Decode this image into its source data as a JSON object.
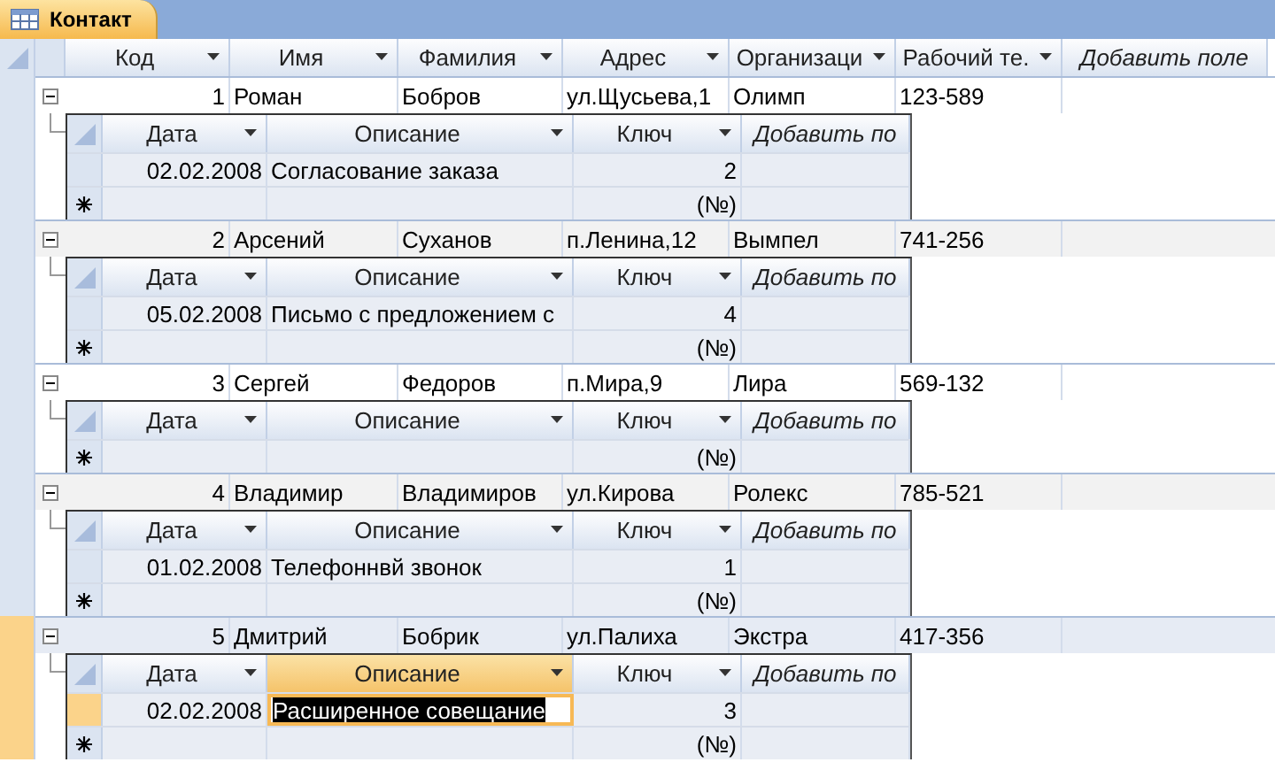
{
  "tab": {
    "label": "Контакт",
    "selected": true
  },
  "columns": [
    {
      "label": "Код",
      "kind": "field"
    },
    {
      "label": "Имя",
      "kind": "field"
    },
    {
      "label": "Фамилия",
      "kind": "field"
    },
    {
      "label": "Адрес",
      "kind": "field"
    },
    {
      "label": "Организаци",
      "kind": "field"
    },
    {
      "label": "Рабочий те.",
      "kind": "field"
    },
    {
      "label": "Добавить поле",
      "kind": "add"
    }
  ],
  "contacts": [
    {
      "selected": false,
      "expanded": true,
      "cells": [
        "1",
        "Роман",
        "Бобров",
        "ул.Щусьева,1",
        "Олимп",
        "123-589"
      ],
      "sub_columns": [
        {
          "label": "Дата",
          "kind": "field",
          "selected": false
        },
        {
          "label": "Описание",
          "kind": "field",
          "selected": false
        },
        {
          "label": "Ключ",
          "kind": "field",
          "selected": false
        },
        {
          "label": "Добавить по",
          "kind": "add",
          "selected": false
        }
      ],
      "records": [
        {
          "selected": false,
          "cells": [
            "02.02.2008",
            "Согласование заказа",
            "2"
          ]
        }
      ],
      "new_key": "(№)"
    },
    {
      "selected": false,
      "expanded": true,
      "cells": [
        "2",
        "Арсений",
        "Суханов",
        "п.Ленина,12",
        "Вымпел",
        "741-256"
      ],
      "sub_columns": [
        {
          "label": "Дата",
          "kind": "field",
          "selected": false
        },
        {
          "label": "Описание",
          "kind": "field",
          "selected": false
        },
        {
          "label": "Ключ",
          "kind": "field",
          "selected": false
        },
        {
          "label": "Добавить по",
          "kind": "add",
          "selected": false
        }
      ],
      "records": [
        {
          "selected": false,
          "cells": [
            "05.02.2008",
            "Письмо с предложением с",
            "4"
          ]
        }
      ],
      "new_key": "(№)"
    },
    {
      "selected": false,
      "expanded": true,
      "cells": [
        "3",
        "Сергей",
        "Федоров",
        "п.Мира,9",
        "Лира",
        "569-132"
      ],
      "sub_columns": [
        {
          "label": "Дата",
          "kind": "field",
          "selected": false
        },
        {
          "label": "Описание",
          "kind": "field",
          "selected": false
        },
        {
          "label": "Ключ",
          "kind": "field",
          "selected": false
        },
        {
          "label": "Добавить по",
          "kind": "add",
          "selected": false
        }
      ],
      "new_key": "(№)"
    },
    {
      "selected": false,
      "expanded": true,
      "cells": [
        "4",
        "Владимир",
        "Владимиров",
        "ул.Кирова",
        "Ролекс",
        "785-521"
      ],
      "sub_columns": [
        {
          "label": "Дата",
          "kind": "field",
          "selected": false
        },
        {
          "label": "Описание",
          "kind": "field",
          "selected": false
        },
        {
          "label": "Ключ",
          "kind": "field",
          "selected": false
        },
        {
          "label": "Добавить по",
          "kind": "add",
          "selected": false
        }
      ],
      "records": [
        {
          "selected": false,
          "cells": [
            "01.02.2008",
            "Телефоннвй звонок",
            "1"
          ]
        }
      ],
      "new_key": "(№)"
    },
    {
      "selected": true,
      "expanded": true,
      "cells": [
        "5",
        "Дмитрий",
        "Бобрик",
        "ул.Палиха",
        "Экстра",
        "417-356"
      ],
      "sub_columns": [
        {
          "label": "Дата",
          "kind": "field",
          "selected": false
        },
        {
          "label": "Описание",
          "kind": "field",
          "selected": true
        },
        {
          "label": "Ключ",
          "kind": "field",
          "selected": false
        },
        {
          "label": "Добавить по",
          "kind": "add",
          "selected": false
        }
      ],
      "records": [
        {
          "selected": true,
          "cells": [
            "02.02.2008",
            "Расширенное совещание",
            "3"
          ]
        }
      ],
      "new_key": "(№)"
    }
  ]
}
